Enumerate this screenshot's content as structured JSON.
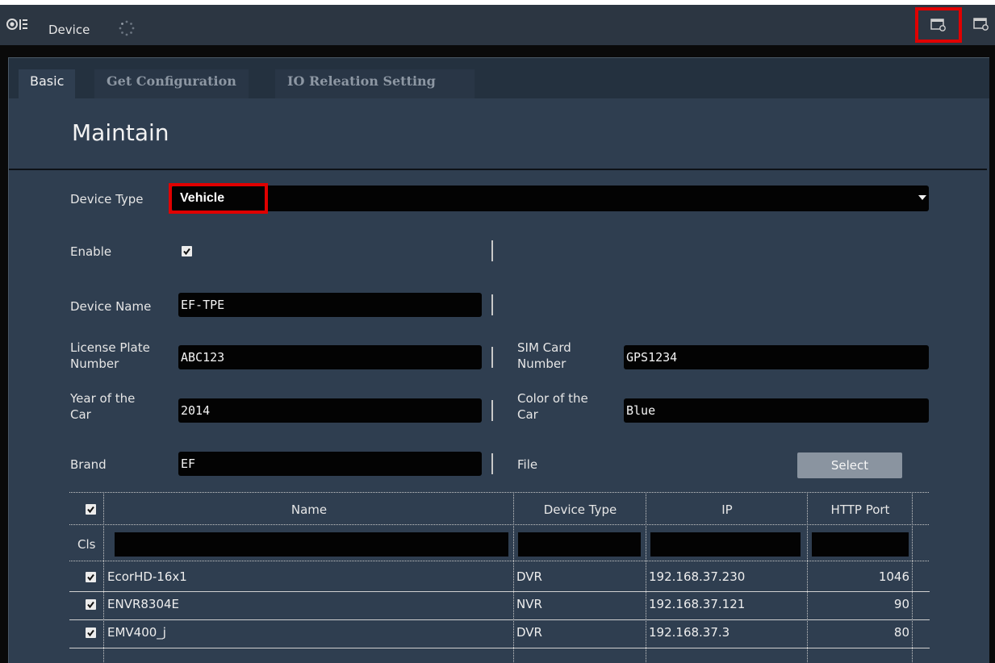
{
  "window": {
    "title": "Device"
  },
  "tabs": [
    {
      "label": "Basic"
    },
    {
      "label": "Get Configuration"
    },
    {
      "label": "IO Releation Setting"
    }
  ],
  "section_title": "Maintain",
  "form": {
    "device_type": {
      "label": "Device Type",
      "value": "Vehicle"
    },
    "enable": {
      "label": "Enable",
      "checked": true
    },
    "device_name": {
      "label": "Device Name",
      "value": "EF-TPE"
    },
    "license_plate": {
      "label_line1": "License Plate",
      "label_line2": "Number",
      "value": "ABC123"
    },
    "sim_card": {
      "label_line1": "SIM Card",
      "label_line2": "Number",
      "value": "GPS1234"
    },
    "year": {
      "label_line1": "Year of the",
      "label_line2": "Car",
      "value": "2014"
    },
    "color": {
      "label_line1": "Color of the",
      "label_line2": "Car",
      "value": "Blue"
    },
    "brand": {
      "label": "Brand",
      "value": "EF"
    },
    "file": {
      "label": "File",
      "button": "Select"
    }
  },
  "table": {
    "headers": [
      "Name",
      "Device Type",
      "IP",
      "HTTP Port"
    ],
    "filter_label": "Cls",
    "rows": [
      {
        "checked": true,
        "name": "EcorHD-16x1",
        "type": "DVR",
        "ip": "192.168.37.230",
        "port": "1046"
      },
      {
        "checked": true,
        "name": "ENVR8304E",
        "type": "NVR",
        "ip": "192.168.37.121",
        "port": "90"
      },
      {
        "checked": true,
        "name": "EMV400_j",
        "type": "DVR",
        "ip": "192.168.37.3",
        "port": "80"
      }
    ]
  },
  "colors": {
    "highlight": "#e00000",
    "panel": "#2f3e50",
    "titlebar": "#2c3642"
  },
  "icons": [
    "app-logo-icon",
    "loading-spinner-icon",
    "window-settings-icon",
    "window-settings-icon-2",
    "dropdown-caret-icon",
    "checkbox-checked-icon"
  ]
}
